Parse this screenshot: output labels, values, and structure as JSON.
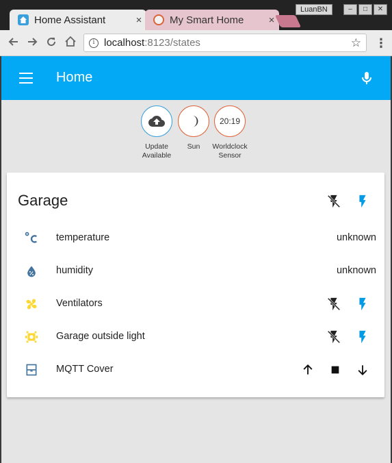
{
  "browser": {
    "tabs": [
      {
        "title": "Home Assistant",
        "close": "×"
      },
      {
        "title": "My Smart Home",
        "close": "×"
      }
    ],
    "user": "LuanBN",
    "url_host": "localhost",
    "url_rest": ":8123/states",
    "info_glyph": "i",
    "win_min": "–",
    "win_max": "□",
    "win_close": "✕"
  },
  "app": {
    "title": "Home",
    "accent": "#03a9f4"
  },
  "badges": [
    {
      "label": "Update Available",
      "icon": "cloud-upload-icon"
    },
    {
      "label": "Sun",
      "icon": "moon-icon"
    },
    {
      "value": "20:19",
      "label": "Worldclock Sensor"
    }
  ],
  "card": {
    "title": "Garage",
    "rows": [
      {
        "name": "temperature",
        "state": "unknown",
        "icon": "celsius-icon"
      },
      {
        "name": "humidity",
        "state": "unknown",
        "icon": "water-percent-icon"
      },
      {
        "name": "Ventilators",
        "icon": "fan-icon"
      },
      {
        "name": "Garage outside light",
        "icon": "lightbulb-icon"
      },
      {
        "name": "MQTT Cover",
        "icon": "window-shutter-icon"
      }
    ]
  }
}
